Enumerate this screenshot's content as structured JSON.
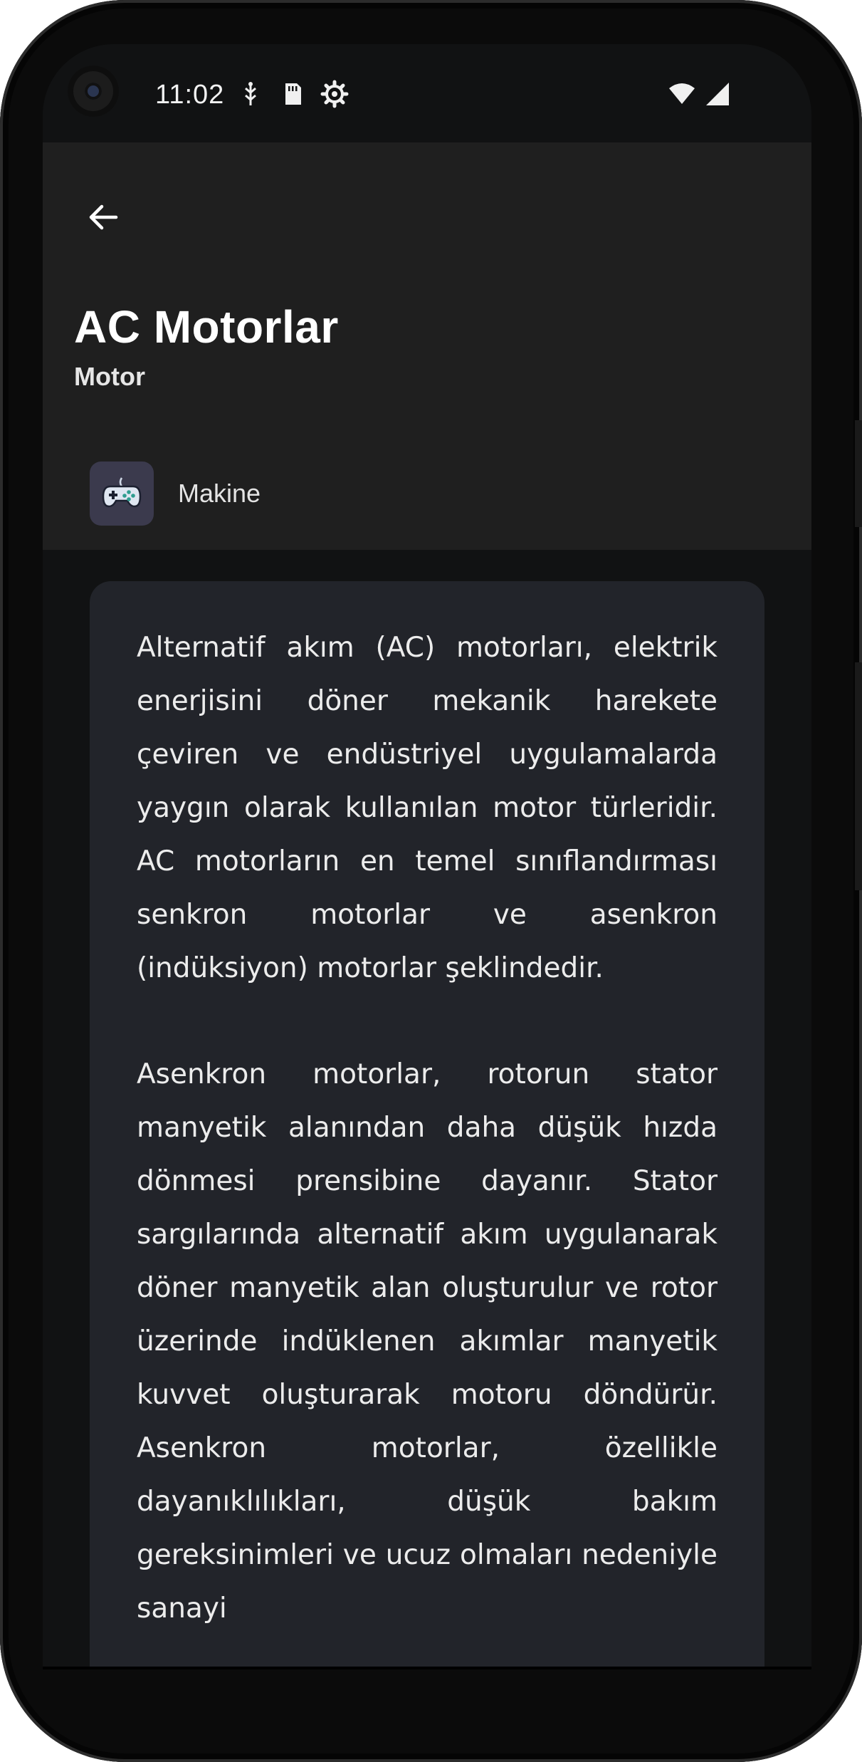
{
  "status_bar": {
    "time": "11:02",
    "icons": [
      "usb-debug-icon",
      "sd-card-icon",
      "settings-gear-icon",
      "wifi-icon",
      "cellular-signal-icon"
    ]
  },
  "header": {
    "back_icon": "arrow-left-icon",
    "title": "AC Motorlar",
    "subtitle": "Motor",
    "category": {
      "icon": "gamepad-icon",
      "label": "Makine"
    }
  },
  "content": {
    "paragraphs": [
      "Alternatif akım (AC) motorları, elektrik enerjisini döner mekanik harekete çeviren ve endüstriyel uygulamalarda yaygın olarak kullanılan motor türleridir. AC motorların en temel sınıflandırması senkron motorlar ve asenkron (indüksiyon) motorlar şeklindedir.",
      "Asenkron motorlar, rotorun stator manyetik alanından daha düşük hızda dönmesi prensibine dayanır. Stator sargılarında alternatif akım uygulanarak döner manyetik alan oluşturulur ve rotor üzerinde indüklenen akımlar manyetik kuvvet oluşturarak motoru döndürür. Asenkron motorlar, özellikle dayanıklılıkları, düşük bakım gereksinimleri ve ucuz olmaları nedeniyle sanayi"
    ]
  },
  "colors": {
    "screen_background": "#111213",
    "header_background": "#1f1f1f",
    "card_background": "#22242a",
    "category_icon_background": "#3b3a4d"
  }
}
